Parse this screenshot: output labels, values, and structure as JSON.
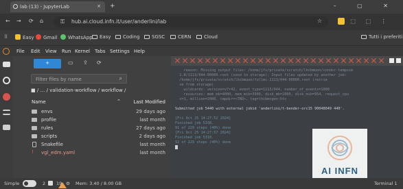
{
  "browser": {
    "tab_title": "lab (13) - JupyterLab",
    "tab_close": "×",
    "new_tab": "+",
    "window_controls": "–  ▢  ✕",
    "url": "hub.ai.cloud.infn.it/user/anderlini/lab",
    "nav_back": "←",
    "nav_forward": "→",
    "nav_reload": "⟳",
    "nav_home": "⌂",
    "lock_icon": "⚿",
    "star_icon": "☆",
    "ext_icons": "⬚ ⬚ ⋮",
    "profile_label": "Tutti i preferiti"
  },
  "bookmarks": [
    {
      "label": "Easy",
      "icon": "yellow"
    },
    {
      "label": "Gmail",
      "icon": "red"
    },
    {
      "label": "WhatsApp",
      "icon": "green"
    },
    {
      "label": "Easy",
      "icon": "folder"
    },
    {
      "label": "Coding",
      "icon": "folder"
    },
    {
      "label": "SGSC",
      "icon": "folder"
    },
    {
      "label": "CERN",
      "icon": "folder"
    },
    {
      "label": "Cloud",
      "icon": "folder"
    }
  ],
  "menu": [
    "File",
    "Edit",
    "View",
    "Run",
    "Kernel",
    "Tabs",
    "Settings",
    "Help"
  ],
  "filebrowser": {
    "new_label": "+",
    "upload_icon": "⇪",
    "folder_icon": "▭",
    "refresh_icon": "⟳",
    "filter_placeholder": "Filter files by name",
    "search_icon": "⌕",
    "breadcrumb": "■ / … / validation-workflow / workflow /",
    "col_name": "Name",
    "col_sort": "⌃",
    "col_modified": "Last Modified",
    "rows": [
      {
        "name": "envs",
        "modified": "29 days ago",
        "type": "folder"
      },
      {
        "name": "profile",
        "modified": "last month",
        "type": "folder"
      },
      {
        "name": "rules",
        "modified": "27 days ago",
        "type": "folder"
      },
      {
        "name": "scripts",
        "modified": "2 days ago",
        "type": "folder"
      },
      {
        "name": "Snakefile",
        "modified": "last month",
        "type": "file"
      },
      {
        "name": "vgl_edm.yaml",
        "modified": "last month",
        "type": "yaml"
      }
    ]
  },
  "terminal": {
    "lines": [
      {
        "text": "    reason: Missing output files: /home/jfs/private/scratch/lhcbmuon/condor-tempsim",
        "cls": ""
      },
      {
        "text": "  1.8/1113/044-00000.root (send to storage); Input files updated by another job:",
        "cls": ""
      },
      {
        "text": "  /home/jfs/private/scratch/lhcbmuon/fullmc-1113/044-00000.root (retrie",
        "cls": ""
      },
      {
        "text": "  ve from storage)",
        "cls": ""
      },
      {
        "text": "    wildcards: version=v7r42, event_type=1113/044, number_of_events=1000",
        "cls": ""
      },
      {
        "text": "    resources: mem_mb=4000, mem_mib=3900, disk_mb=1000, disk_mib=954, request_cpu",
        "cls": ""
      },
      {
        "text": "  s=1, million=2000, tmpdir=<TBD>, tag=lhcbmcgen-htc",
        "cls": ""
      },
      {
        "text": "",
        "cls": ""
      },
      {
        "text": "Submitted job 5440 with external jobid 'anderlini/t-bender-orc15 90048049 440'.",
        "cls": "hl"
      },
      {
        "text": "",
        "cls": ""
      },
      {
        "text": "[Fri Oct 25 14:27:52 2024]",
        "cls": "gr"
      },
      {
        "text": "Finished job 5338.",
        "cls": "gr"
      },
      {
        "text": "91 of 229 steps (40%) done",
        "cls": "gr"
      },
      {
        "text": "[Fri Oct 25 14:27:57 2024]",
        "cls": "gr"
      },
      {
        "text": "Finished job 5310.",
        "cls": "gr"
      },
      {
        "text": "92 of 229 steps (40%) done",
        "cls": "gr"
      }
    ]
  },
  "watermark": {
    "text": "AI INFN"
  },
  "status": {
    "mode": "Simple",
    "kernels": "2",
    "terminals": "19",
    "settings_icon": "⚙",
    "memory": "Mem: 3.40 / 8.00 GB",
    "right": "Terminal 1"
  }
}
